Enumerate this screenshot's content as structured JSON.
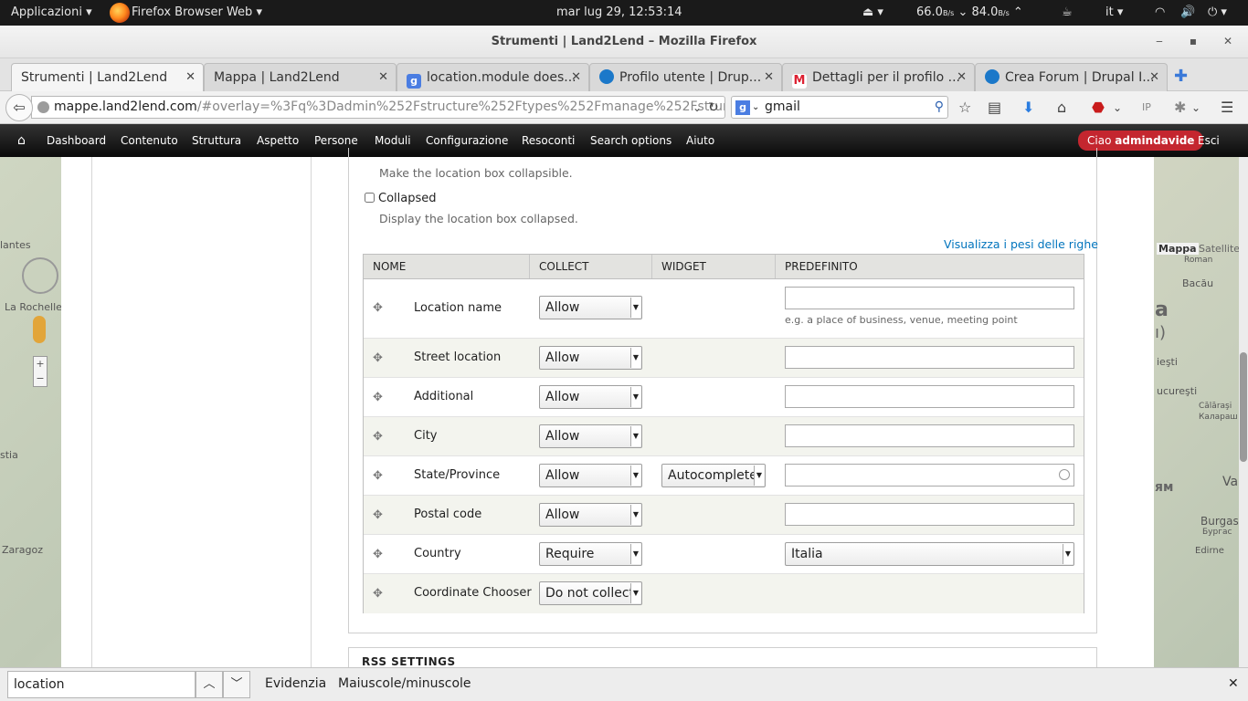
{
  "gnome": {
    "apps_menu": "Applicazioni ▾",
    "app_name": "Firefox Browser Web ▾",
    "clock": "mar lug 29, 12:53:14",
    "net_down": "66.0",
    "net_up": "84.0",
    "net_unit": "B/s",
    "language": "it ▾"
  },
  "window": {
    "title": "Strumenti | Land2Lend – Mozilla Firefox"
  },
  "tabs": [
    {
      "label": "Strumenti | Land2Lend",
      "favicon": "none"
    },
    {
      "label": "Mappa | Land2Lend",
      "favicon": "none"
    },
    {
      "label": "location.module does...",
      "favicon": "google-icon"
    },
    {
      "label": "Profilo utente | Drup...",
      "favicon": "drupal-icon"
    },
    {
      "label": "Dettagli per il profilo ...",
      "favicon": "gmail-icon"
    },
    {
      "label": "Crea Forum | Drupal I...",
      "favicon": "drupal-icon"
    }
  ],
  "navbar": {
    "url_host": "mappe.land2lend.com",
    "url_rest": "/#overlay=%3Fq%3Dadmin%252Fstructure%252Ftypes%252Fmanage%252Fstrumen",
    "search_value": "gmail"
  },
  "toolbar": {
    "items": [
      "Dashboard",
      "Contenuto",
      "Struttura",
      "Aspetto",
      "Persone",
      "Moduli",
      "Configurazione",
      "Resoconti",
      "Search options",
      "Aiuto"
    ],
    "greeting": "Ciao",
    "username": "admindavide",
    "logout": "Esci"
  },
  "map": {
    "labels": [
      "lantes",
      "La Rochelle",
      "stia",
      "Zaragoz",
      "Mappa",
      "Satellite",
      "Roman",
      "Bacău",
      "a",
      "ı)",
      "ieşti",
      "ucureşti",
      "Călăraşi",
      "Калараш",
      "Va",
      "ям",
      "Burgas",
      "Бургас",
      "Edirne"
    ]
  },
  "form": {
    "collapsible_desc": "Make the location box collapsible.",
    "collapsed_label": "Collapsed",
    "collapsed_desc": "Display the location box collapsed.",
    "weights_link": "Visualizza i pesi delle righe",
    "columns": [
      "NOME",
      "COLLECT",
      "WIDGET",
      "PREDEFINITO"
    ],
    "rows": [
      {
        "name": "Location name",
        "collect": "Allow",
        "widget": "",
        "default": "",
        "hint": "e.g. a place of business, venue, meeting point"
      },
      {
        "name": "Street location",
        "collect": "Allow",
        "widget": "",
        "default": ""
      },
      {
        "name": "Additional",
        "collect": "Allow",
        "widget": "",
        "default": ""
      },
      {
        "name": "City",
        "collect": "Allow",
        "widget": "",
        "default": ""
      },
      {
        "name": "State/Province",
        "collect": "Allow",
        "widget": "Autocomplete",
        "default": ""
      },
      {
        "name": "Postal code",
        "collect": "Allow",
        "widget": "",
        "default": ""
      },
      {
        "name": "Country",
        "collect": "Require",
        "widget": "",
        "default": "Italia"
      },
      {
        "name": "Coordinate Chooser",
        "collect": "Do not collect",
        "widget": "",
        "default": ""
      }
    ],
    "rss_heading": "RSS SETTINGS"
  },
  "findbar": {
    "query": "location",
    "highlight": "Evidenzia",
    "match_case": "Maiuscole/minuscole"
  }
}
